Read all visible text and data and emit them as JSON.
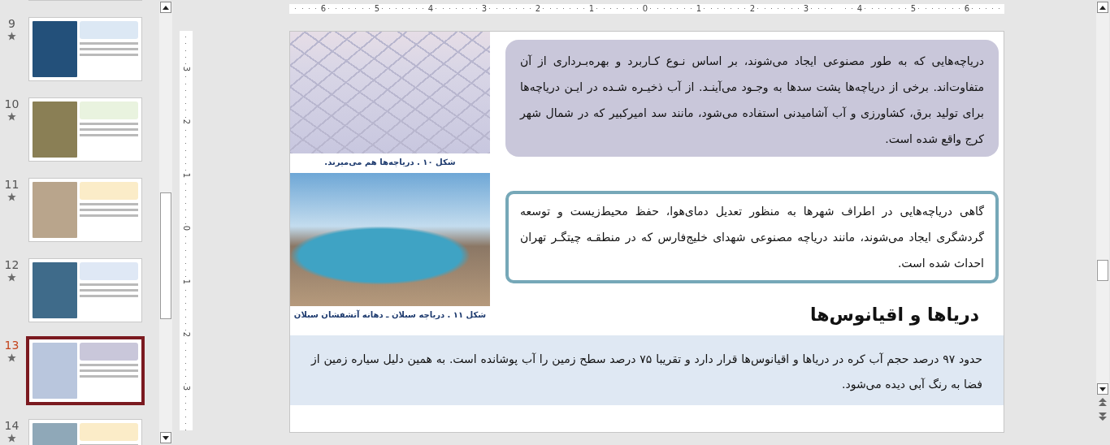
{
  "slide_panel": {
    "thumbnails": [
      {
        "kind": "clipped",
        "selected": false
      },
      {
        "kind": "full",
        "number": "9",
        "selected": false
      },
      {
        "kind": "full",
        "number": "10",
        "selected": false
      },
      {
        "kind": "full",
        "number": "11",
        "selected": false
      },
      {
        "kind": "full",
        "number": "12",
        "selected": false
      },
      {
        "kind": "full",
        "number": "13",
        "selected": true
      },
      {
        "kind": "full",
        "number": "14",
        "selected": false
      }
    ]
  },
  "horizontal_ruler": {
    "labels": [
      "6",
      "5",
      "4",
      "3",
      "2",
      "1",
      "0",
      "1",
      "2",
      "3",
      "4",
      "5",
      "6"
    ]
  },
  "vertical_ruler": {
    "labels": [
      "3",
      "2",
      "1",
      "0",
      "1",
      "2",
      "3"
    ]
  },
  "slide": {
    "figures": [
      {
        "kind": "salt-flat",
        "caption": "شکل ۱۰ . دریاچه‌ها هم می‌میرند."
      },
      {
        "kind": "crater-lake",
        "caption": "شکل ۱۱ . دریاچه سبلان ـ دهانه آتشفشان سبلان"
      }
    ],
    "boxes": [
      {
        "kind": "filled",
        "text": "دریاچه‌هایی که به طور مصنوعی ایجاد می‌شوند، بر اساس نـوع کـاربرد و بهره‌بـرداری از آن متفاوت‌اند. برخی از دریاچه‌ها پشت سدها به وجـود می‌آینـد. از آب ذخیـره شـده در ایـن دریاچه‌ها برای تولید برق، کشاورزی و آب آشامیدنی استفاده می‌شود، مانند سد امیرکبیر که در شمال شهر کرج واقع شده است."
      },
      {
        "kind": "outlined",
        "text": "گاهی دریاچه‌هایی در اطراف شهرها به منظور تعدیل دمای‌هوا، حفظ محیط‌زیست و توسعه گردشگری ایجاد می‌شوند، مانند دریاچه مصنوعی شهدای خلیج‌فارس که در منطقـه چیتگـر تهران احداث شده است."
      }
    ],
    "heading": "دریاها و اقیانوس‌ها",
    "band_text": "حدود ۹۷ درصد حجم آب کره در دریاها و اقیانوس‌ها قرار دارد و تقریبا ۷۵ درصد سطح زمین را آب پوشانده است. به همین دلیل سیاره زمین از فضا به رنگ آبی دیده می‌شود."
  }
}
